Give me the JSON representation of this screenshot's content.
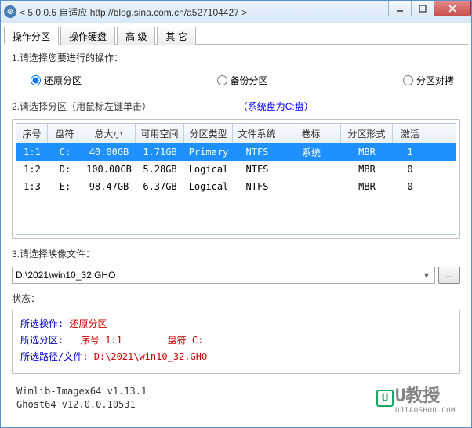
{
  "titlebar": {
    "title": "< 5.0.0.5 自适应 http://blog.sina.com.cn/a527104427 >"
  },
  "tabs": [
    {
      "label": "操作分区",
      "active": true
    },
    {
      "label": "操作硬盘",
      "active": false
    },
    {
      "label": "高 级",
      "active": false
    },
    {
      "label": "其 它",
      "active": false
    }
  ],
  "section1": {
    "label": "1.请选择您要进行的操作：",
    "options": [
      {
        "label": "还原分区",
        "checked": true
      },
      {
        "label": "备份分区",
        "checked": false
      },
      {
        "label": "分区对拷",
        "checked": false
      }
    ]
  },
  "section2": {
    "label": "2.请选择分区（用鼠标左键单击）",
    "note": "（系统盘为C:盘）",
    "headers": [
      "序号",
      "盘符",
      "总大小",
      "可用空间",
      "分区类型",
      "文件系统",
      "卷标",
      "分区形式",
      "激活"
    ],
    "rows": [
      {
        "selected": true,
        "cells": [
          "1:1",
          "C:",
          "40.00GB",
          "1.71GB",
          "Primary",
          "NTFS",
          "系统",
          "MBR",
          "1"
        ]
      },
      {
        "selected": false,
        "cells": [
          "1:2",
          "D:",
          "100.00GB",
          "5.28GB",
          "Logical",
          "NTFS",
          "",
          "MBR",
          "0"
        ]
      },
      {
        "selected": false,
        "cells": [
          "1:3",
          "E:",
          "98.47GB",
          "6.37GB",
          "Logical",
          "NTFS",
          "",
          "MBR",
          "0"
        ]
      }
    ]
  },
  "section3": {
    "label": "3.请选择映像文件：",
    "value": "D:\\2021\\win10_32.GHO",
    "browse": "..."
  },
  "status": {
    "label": "状态：",
    "op_lbl": "所选操作:",
    "op_val": "还原分区",
    "part_lbl": "所选分区:",
    "part_idx_lbl": "序号",
    "part_idx_val": "1:1",
    "drive_lbl": "盘符",
    "drive_val": "C:",
    "path_lbl": "所选路径/文件:",
    "path_val": "D:\\2021\\win10_32.GHO"
  },
  "footer": {
    "line1": "Wimlib-Imagex64 v1.13.1",
    "line2": "Ghost64 v12.0.0.10531",
    "watermark": "U教授",
    "watermark_sub": "UJIAOSHOU.COM",
    "logo_letter": "U"
  }
}
